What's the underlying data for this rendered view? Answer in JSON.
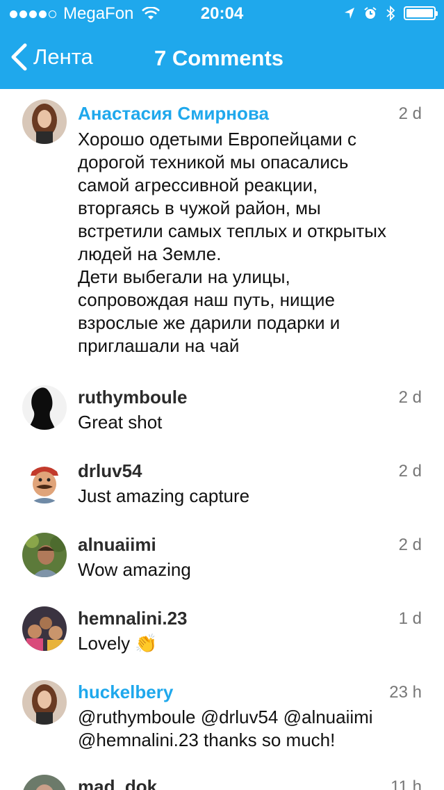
{
  "statusbar": {
    "carrier": "MegaFon",
    "time": "20:04"
  },
  "navbar": {
    "back_label": "Лента",
    "title": "7 Comments"
  },
  "colors": {
    "accent": "#1fa8ec",
    "text": "#111111",
    "muted": "#777777"
  },
  "comments": [
    {
      "username": "Анастасия Смирнова",
      "highlight": true,
      "time": "2 d",
      "text": "Хорошо одетыми Европейцами с\nдорогой техникой мы опасались\nсамой агрессивной реакции,\nвторгаясь в чужой район, мы\nвстретили самых теплых и открытых\nлюдей на Земле.\nДети выбегали на улицы,\nсопровождая наш путь, нищие\nвзрослые же дарили подарки и\nприглашали на чай"
    },
    {
      "username": "ruthymboule",
      "highlight": false,
      "time": "2 d",
      "text": "Great shot"
    },
    {
      "username": "drluv54",
      "highlight": false,
      "time": "2 d",
      "text": "Just amazing capture"
    },
    {
      "username": "alnuaiimi",
      "highlight": false,
      "time": "2 d",
      "text": "Wow amazing"
    },
    {
      "username": "hemnalini.23",
      "highlight": false,
      "time": "1 d",
      "text": "Lovely 👏"
    },
    {
      "username": "huckelbery",
      "highlight": true,
      "time": "23 h",
      "text": "@ruthymboule @drluv54 @alnuaiimi\n@hemnalini.23 thanks so much!"
    },
    {
      "username": "mad_dok",
      "highlight": false,
      "time": "11 h",
      "text": ""
    }
  ]
}
